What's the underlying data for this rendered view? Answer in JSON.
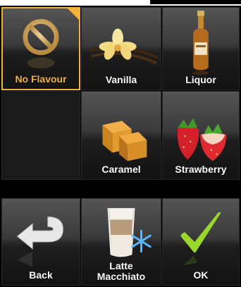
{
  "tiles": {
    "no_flavour": "No Flavour",
    "vanilla": "Vanilla",
    "liquor": "Liquor",
    "caramel": "Caramel",
    "strawberry": "Strawberry"
  },
  "bottom": {
    "back": "Back",
    "drink_line1": "Latte",
    "drink_line2": "Macchiato",
    "ok": "OK"
  },
  "colors": {
    "selected_accent": "#f3b238",
    "ok_check": "#9bd62a",
    "background": "#000000"
  },
  "state": {
    "selected_flavour": "No Flavour"
  }
}
